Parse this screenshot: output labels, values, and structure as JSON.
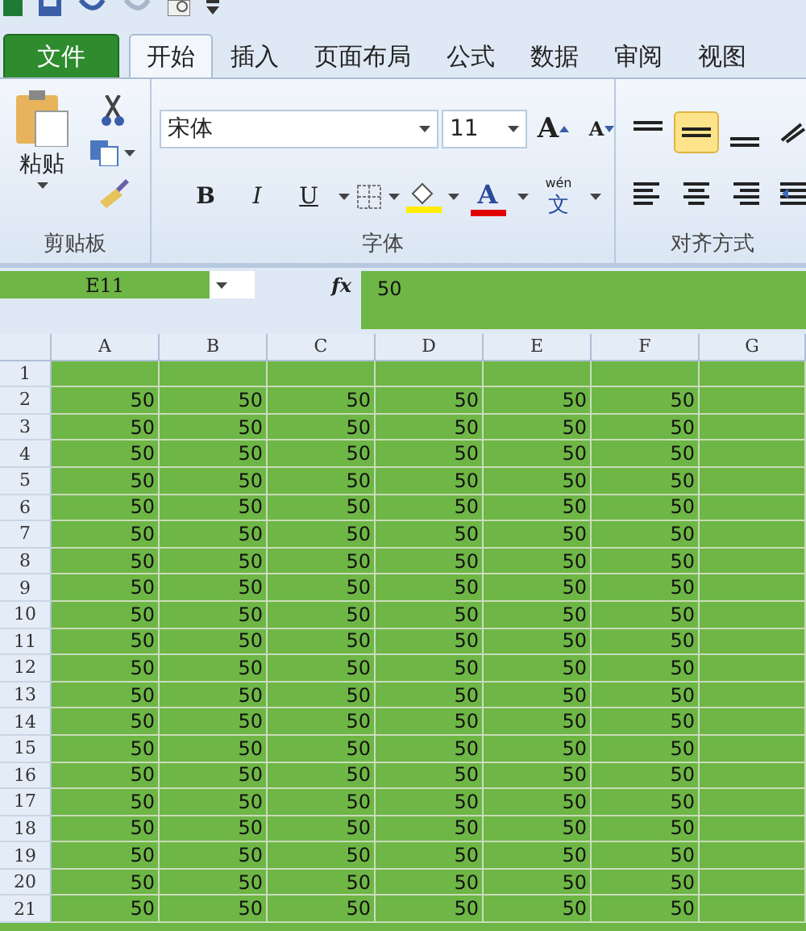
{
  "tabs": [
    {
      "label": "文件",
      "kind": "file",
      "selected": false
    },
    {
      "label": "开始",
      "kind": "tab",
      "selected": true
    },
    {
      "label": "插入",
      "kind": "tab",
      "selected": false
    },
    {
      "label": "页面布局",
      "kind": "tab",
      "selected": false
    },
    {
      "label": "公式",
      "kind": "tab",
      "selected": false
    },
    {
      "label": "数据",
      "kind": "tab",
      "selected": false
    },
    {
      "label": "审阅",
      "kind": "tab",
      "selected": false
    },
    {
      "label": "视图",
      "kind": "tab",
      "selected": false
    }
  ],
  "clipboard": {
    "paste": "粘贴",
    "label": "剪贴板"
  },
  "font": {
    "name": "宋体",
    "size": "11",
    "grow": "A",
    "shrink": "A",
    "bold": "B",
    "italic": "I",
    "underline": "U",
    "color_letter": "A",
    "phonetic_top": "wén",
    "phonetic_main": "文",
    "label": "字体"
  },
  "alignment": {
    "buttons": [
      {
        "kind": "top",
        "selected": false
      },
      {
        "kind": "middle",
        "selected": true
      },
      {
        "kind": "bottom",
        "selected": false
      },
      {
        "kind": "orient",
        "selected": false
      },
      {
        "kind": "left",
        "selected": false
      },
      {
        "kind": "center",
        "selected": false
      },
      {
        "kind": "right",
        "selected": false
      },
      {
        "kind": "indent",
        "selected": false
      }
    ],
    "label": "对齐方式"
  },
  "formula_bar": {
    "name_box": "E11",
    "fx": "fx",
    "value": "50"
  },
  "sheet": {
    "columns": [
      "A",
      "B",
      "C",
      "D",
      "E",
      "F",
      "G"
    ],
    "rows": [
      {
        "header": "1"
      },
      {
        "header": "2",
        "cells": [
          "50",
          "50",
          "50",
          "50",
          "50",
          "50"
        ]
      },
      {
        "header": "3",
        "cells": [
          "50",
          "50",
          "50",
          "50",
          "50",
          "50"
        ]
      },
      {
        "header": "4",
        "cells": [
          "50",
          "50",
          "50",
          "50",
          "50",
          "50"
        ]
      },
      {
        "header": "5",
        "cells": [
          "50",
          "50",
          "50",
          "50",
          "50",
          "50"
        ]
      },
      {
        "header": "6",
        "cells": [
          "50",
          "50",
          "50",
          "50",
          "50",
          "50"
        ]
      },
      {
        "header": "7",
        "cells": [
          "50",
          "50",
          "50",
          "50",
          "50",
          "50"
        ]
      },
      {
        "header": "8",
        "cells": [
          "50",
          "50",
          "50",
          "50",
          "50",
          "50"
        ]
      },
      {
        "header": "9",
        "cells": [
          "50",
          "50",
          "50",
          "50",
          "50",
          "50"
        ]
      },
      {
        "header": "10",
        "cells": [
          "50",
          "50",
          "50",
          "50",
          "50",
          "50"
        ]
      },
      {
        "header": "11",
        "cells": [
          "50",
          "50",
          "50",
          "50",
          "50",
          "50"
        ]
      },
      {
        "header": "12",
        "cells": [
          "50",
          "50",
          "50",
          "50",
          "50",
          "50"
        ]
      },
      {
        "header": "13",
        "cells": [
          "50",
          "50",
          "50",
          "50",
          "50",
          "50"
        ]
      },
      {
        "header": "14",
        "cells": [
          "50",
          "50",
          "50",
          "50",
          "50",
          "50"
        ]
      },
      {
        "header": "15",
        "cells": [
          "50",
          "50",
          "50",
          "50",
          "50",
          "50"
        ]
      },
      {
        "header": "16",
        "cells": [
          "50",
          "50",
          "50",
          "50",
          "50",
          "50"
        ]
      },
      {
        "header": "17",
        "cells": [
          "50",
          "50",
          "50",
          "50",
          "50",
          "50"
        ]
      },
      {
        "header": "18",
        "cells": [
          "50",
          "50",
          "50",
          "50",
          "50",
          "50"
        ]
      },
      {
        "header": "19",
        "cells": [
          "50",
          "50",
          "50",
          "50",
          "50",
          "50"
        ]
      },
      {
        "header": "20",
        "cells": [
          "50",
          "50",
          "50",
          "50",
          "50",
          "50"
        ]
      },
      {
        "header": "21",
        "cells": [
          "50",
          "50",
          "50",
          "50",
          "50",
          "50"
        ]
      }
    ]
  }
}
